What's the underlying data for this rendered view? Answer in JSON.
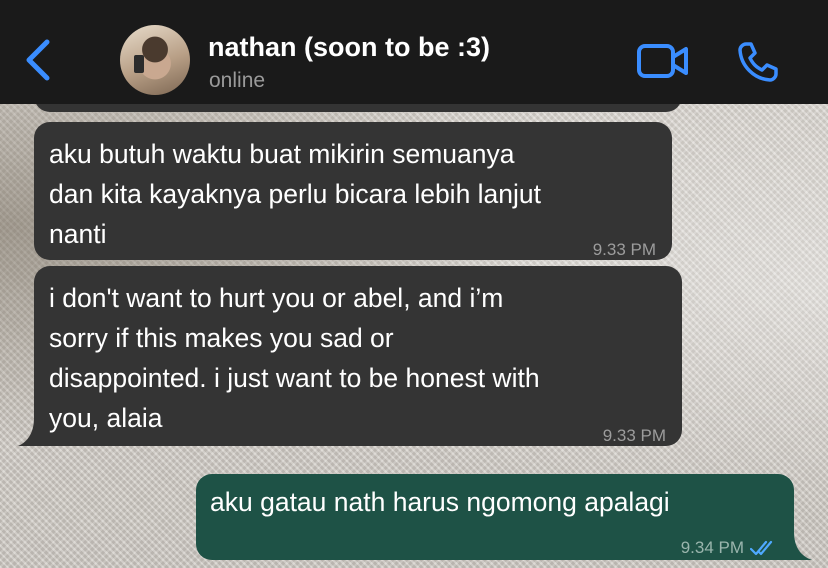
{
  "header": {
    "contact_name": "nathan (soon to be :3)",
    "status": "online"
  },
  "icons": {
    "back": "chevron-left-icon",
    "video": "video-camera-icon",
    "call": "phone-icon",
    "read": "double-check-icon"
  },
  "colors": {
    "accent": "#3a8dff",
    "header_bg": "#1a1a1a",
    "incoming_bubble": "#343434",
    "outgoing_bubble": "#1e5246"
  },
  "messages": [
    {
      "direction": "in",
      "lines": [
        "aku butuh waktu buat mikirin semuanya",
        "dan kita kayaknya perlu bicara lebih lanjut",
        "nanti"
      ],
      "time": "9.33 PM"
    },
    {
      "direction": "in",
      "lines": [
        "i don't want to hurt you or abel, and i’m",
        "sorry if this makes you sad or",
        "disappointed. i just want to be honest with",
        "you, alaia"
      ],
      "time": "9.33 PM"
    },
    {
      "direction": "out",
      "lines": [
        "aku gatau nath harus ngomong apalagi"
      ],
      "time": "9.34 PM",
      "read": true
    }
  ]
}
